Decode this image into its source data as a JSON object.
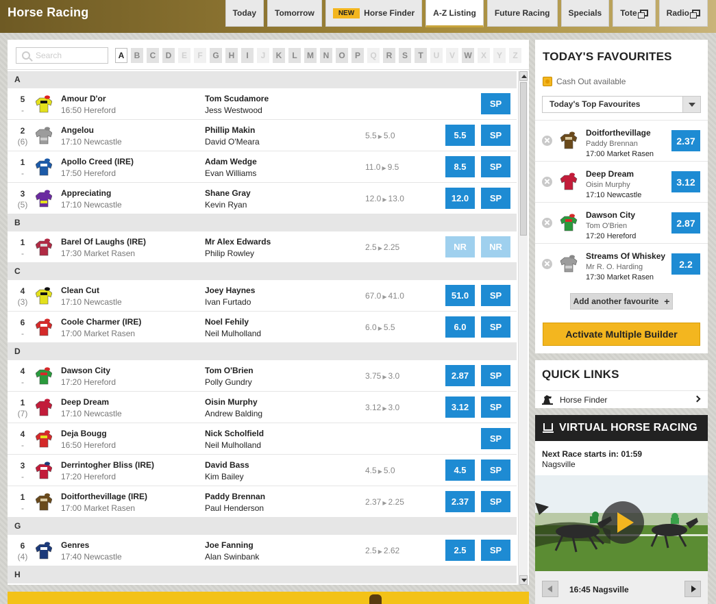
{
  "header": {
    "title": "Horse Racing",
    "tabs": [
      {
        "label": "Today",
        "badge": null,
        "external": false,
        "active": false
      },
      {
        "label": "Tomorrow",
        "badge": null,
        "external": false,
        "active": false
      },
      {
        "label": "Horse Finder",
        "badge": "NEW",
        "external": false,
        "active": false
      },
      {
        "label": "A-Z Listing",
        "badge": null,
        "external": false,
        "active": true
      },
      {
        "label": "Future Racing",
        "badge": null,
        "external": false,
        "active": false
      },
      {
        "label": "Specials",
        "badge": null,
        "external": false,
        "active": false
      },
      {
        "label": "Tote",
        "badge": null,
        "external": true,
        "active": false
      },
      {
        "label": "Radio",
        "badge": null,
        "external": true,
        "active": false
      }
    ]
  },
  "search": {
    "placeholder": "Search"
  },
  "letters": [
    {
      "l": "A",
      "state": "active"
    },
    {
      "l": "B",
      "state": "on"
    },
    {
      "l": "C",
      "state": "on"
    },
    {
      "l": "D",
      "state": "on"
    },
    {
      "l": "E",
      "state": "off"
    },
    {
      "l": "F",
      "state": "off"
    },
    {
      "l": "G",
      "state": "on"
    },
    {
      "l": "H",
      "state": "on"
    },
    {
      "l": "I",
      "state": "on"
    },
    {
      "l": "J",
      "state": "off"
    },
    {
      "l": "K",
      "state": "on"
    },
    {
      "l": "L",
      "state": "on"
    },
    {
      "l": "M",
      "state": "on"
    },
    {
      "l": "N",
      "state": "on"
    },
    {
      "l": "O",
      "state": "on"
    },
    {
      "l": "P",
      "state": "on"
    },
    {
      "l": "Q",
      "state": "off"
    },
    {
      "l": "R",
      "state": "on"
    },
    {
      "l": "S",
      "state": "on"
    },
    {
      "l": "T",
      "state": "on"
    },
    {
      "l": "U",
      "state": "off"
    },
    {
      "l": "V",
      "state": "off"
    },
    {
      "l": "W",
      "state": "on"
    },
    {
      "l": "X",
      "state": "off"
    },
    {
      "l": "Y",
      "state": "off"
    },
    {
      "l": "Z",
      "state": "off"
    }
  ],
  "sections": [
    {
      "letter": "A",
      "runners": [
        {
          "pos": "5",
          "draw": "-",
          "horse": "Amour D'or",
          "race": "16:50 Hereford",
          "jockey": "Tom Scudamore",
          "trainer": "Jess Westwood",
          "prev": "",
          "now": "",
          "odds": "",
          "sp": "SP",
          "silk": [
            "#e3e01c",
            "#111111",
            "#e3e01c",
            "#d22"
          ]
        },
        {
          "pos": "2",
          "draw": "(6)",
          "horse": "Angelou",
          "race": "17:10 Newcastle",
          "jockey": "Phillip Makin",
          "trainer": "David O'Meara",
          "prev": "5.5",
          "now": "5.0",
          "odds": "5.5",
          "sp": "SP",
          "silk": [
            "#9c9c9c",
            "#9c9c9c",
            "#cfcfcf",
            "#888"
          ]
        },
        {
          "pos": "1",
          "draw": "-",
          "horse": "Apollo Creed (IRE)",
          "race": "17:50 Hereford",
          "jockey": "Adam Wedge",
          "trainer": "Evan Williams",
          "prev": "11.0",
          "now": "9.5",
          "odds": "8.5",
          "sp": "SP",
          "silk": [
            "#1c5aa8",
            "#ffffff",
            "#1c5aa8",
            "#1c5aa8"
          ]
        },
        {
          "pos": "3",
          "draw": "(5)",
          "horse": "Appreciating",
          "race": "17:10 Newcastle",
          "jockey": "Shane Gray",
          "trainer": "Kevin Ryan",
          "prev": "12.0",
          "now": "13.0",
          "odds": "12.0",
          "sp": "SP",
          "silk": [
            "#6a2aa0",
            "#6a2aa0",
            "#e3e01c",
            "#6a2aa0"
          ]
        }
      ]
    },
    {
      "letter": "B",
      "runners": [
        {
          "pos": "1",
          "draw": "-",
          "horse": "Barel Of Laughs (IRE)",
          "race": "17:30 Market Rasen",
          "jockey": "Mr Alex Edwards",
          "trainer": "Philip Rowley",
          "prev": "2.5",
          "now": "2.25",
          "odds": "NR",
          "sp": "NR",
          "silk": [
            "#b02a44",
            "#d9d9d9",
            "#b02a44",
            "#b02a44"
          ]
        }
      ]
    },
    {
      "letter": "C",
      "runners": [
        {
          "pos": "4",
          "draw": "(3)",
          "horse": "Clean Cut",
          "race": "17:10 Newcastle",
          "jockey": "Joey Haynes",
          "trainer": "Ivan Furtado",
          "prev": "67.0",
          "now": "41.0",
          "odds": "51.0",
          "sp": "SP",
          "silk": [
            "#e3e01c",
            "#111111",
            "#e3e01c",
            "#111"
          ]
        },
        {
          "pos": "6",
          "draw": "-",
          "horse": "Coole Charmer (IRE)",
          "race": "17:00 Market Rasen",
          "jockey": "Noel Fehily",
          "trainer": "Neil Mulholland",
          "prev": "6.0",
          "now": "5.5",
          "odds": "6.0",
          "sp": "SP",
          "silk": [
            "#d42a2a",
            "#ffffff",
            "#d42a2a",
            "#d42a2a"
          ]
        }
      ]
    },
    {
      "letter": "D",
      "runners": [
        {
          "pos": "4",
          "draw": "-",
          "horse": "Dawson City",
          "race": "17:20 Hereford",
          "jockey": "Tom O'Brien",
          "trainer": "Polly Gundry",
          "prev": "3.75",
          "now": "3.0",
          "odds": "2.87",
          "sp": "SP",
          "silk": [
            "#2a9a3c",
            "#d42a2a",
            "#2a9a3c",
            "#d42a2a"
          ]
        },
        {
          "pos": "1",
          "draw": "(7)",
          "horse": "Deep Dream",
          "race": "17:10 Newcastle",
          "jockey": "Oisin Murphy",
          "trainer": "Andrew Balding",
          "prev": "3.12",
          "now": "3.0",
          "odds": "3.12",
          "sp": "SP",
          "silk": [
            "#c21c3a",
            "#c21c3a",
            "#c21c3a",
            "#c21c3a"
          ]
        },
        {
          "pos": "4",
          "draw": "-",
          "horse": "Deja Bougg",
          "race": "16:50 Hereford",
          "jockey": "Nick Scholfield",
          "trainer": "Neil Mulholland",
          "prev": "",
          "now": "",
          "odds": "",
          "sp": "SP",
          "silk": [
            "#d42a2a",
            "#e3e01c",
            "#d42a2a",
            "#d42a2a"
          ]
        },
        {
          "pos": "3",
          "draw": "-",
          "horse": "Derrintogher Bliss (IRE)",
          "race": "17:20 Hereford",
          "jockey": "David Bass",
          "trainer": "Kim Bailey",
          "prev": "4.5",
          "now": "5.0",
          "odds": "4.5",
          "sp": "SP",
          "silk": [
            "#c21c3a",
            "#ffffff",
            "#c21c3a",
            "#1c3a7a"
          ]
        },
        {
          "pos": "1",
          "draw": "-",
          "horse": "Doitforthevillage (IRE)",
          "race": "17:00 Market Rasen",
          "jockey": "Paddy Brennan",
          "trainer": "Paul Henderson",
          "prev": "2.37",
          "now": "2.25",
          "odds": "2.37",
          "sp": "SP",
          "silk": [
            "#6a4a1c",
            "#d9c9a0",
            "#6a4a1c",
            "#6a4a1c"
          ]
        }
      ]
    },
    {
      "letter": "G",
      "runners": [
        {
          "pos": "6",
          "draw": "(4)",
          "horse": "Genres",
          "race": "17:40 Newcastle",
          "jockey": "Joe Fanning",
          "trainer": "Alan Swinbank",
          "prev": "2.5",
          "now": "2.62",
          "odds": "2.5",
          "sp": "SP",
          "silk": [
            "#1c3a7a",
            "#ffffff",
            "#1c3a7a",
            "#1c3a7a"
          ]
        }
      ]
    },
    {
      "letter": "H",
      "runners": []
    }
  ],
  "favourites": {
    "title": "TODAY'S FAVOURITES",
    "cash_out": "Cash Out available",
    "select_value": "Today's Top Favourites",
    "items": [
      {
        "horse": "Doitforthevillage",
        "jockey": "Paddy Brennan",
        "race": "17:00 Market Rasen",
        "odds": "2.37",
        "silk": [
          "#6a4a1c",
          "#d9c9a0",
          "#6a4a1c",
          "#6a4a1c"
        ]
      },
      {
        "horse": "Deep Dream",
        "jockey": "Oisin Murphy",
        "race": "17:10 Newcastle",
        "odds": "3.12",
        "silk": [
          "#c21c3a",
          "#c21c3a",
          "#c21c3a",
          "#c21c3a"
        ]
      },
      {
        "horse": "Dawson City",
        "jockey": "Tom O'Brien",
        "race": "17:20 Hereford",
        "odds": "2.87",
        "silk": [
          "#2a9a3c",
          "#d42a2a",
          "#2a9a3c",
          "#d42a2a"
        ]
      },
      {
        "horse": "Streams Of Whiskey",
        "jockey": "Mr R. O. Harding",
        "race": "17:30 Market Rasen",
        "odds": "2.2",
        "silk": [
          "#9c9c9c",
          "#9c9c9c",
          "#cfcfcf",
          "#888"
        ]
      }
    ],
    "add_label": "Add another favourite",
    "activate_label": "Activate Multiple Builder"
  },
  "quick_links": {
    "title": "QUICK LINKS",
    "items": [
      {
        "label": "Horse Finder",
        "icon": "horse-finder-icon"
      }
    ]
  },
  "virtual": {
    "title": "VIRTUAL HORSE RACING",
    "next_race_label": "Next Race starts in:",
    "countdown": "01:59",
    "venue": "Nagsville",
    "race_label": "16:45 Nagsville"
  }
}
